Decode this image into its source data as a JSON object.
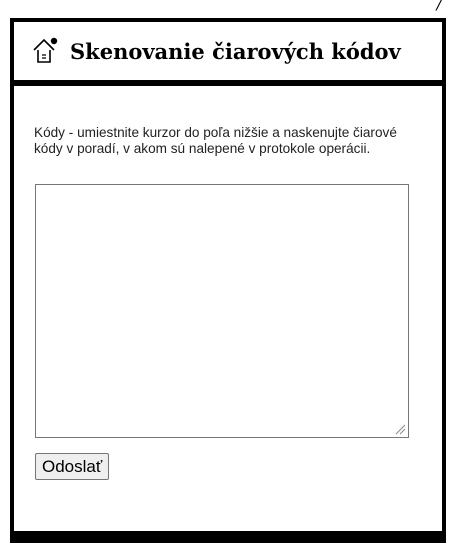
{
  "header": {
    "title": "Skenovanie čiarových kódov",
    "icon": "barcode-scan-arrow-icon"
  },
  "form": {
    "instructions": "Kódy - umiestnite kurzor do poľa nižšie a naskenujte čiarové kódy v poradí, v akom sú nalepené v protokole operácii.",
    "codes_value": "",
    "submit_label": "Odoslať"
  },
  "top_mark": "/"
}
